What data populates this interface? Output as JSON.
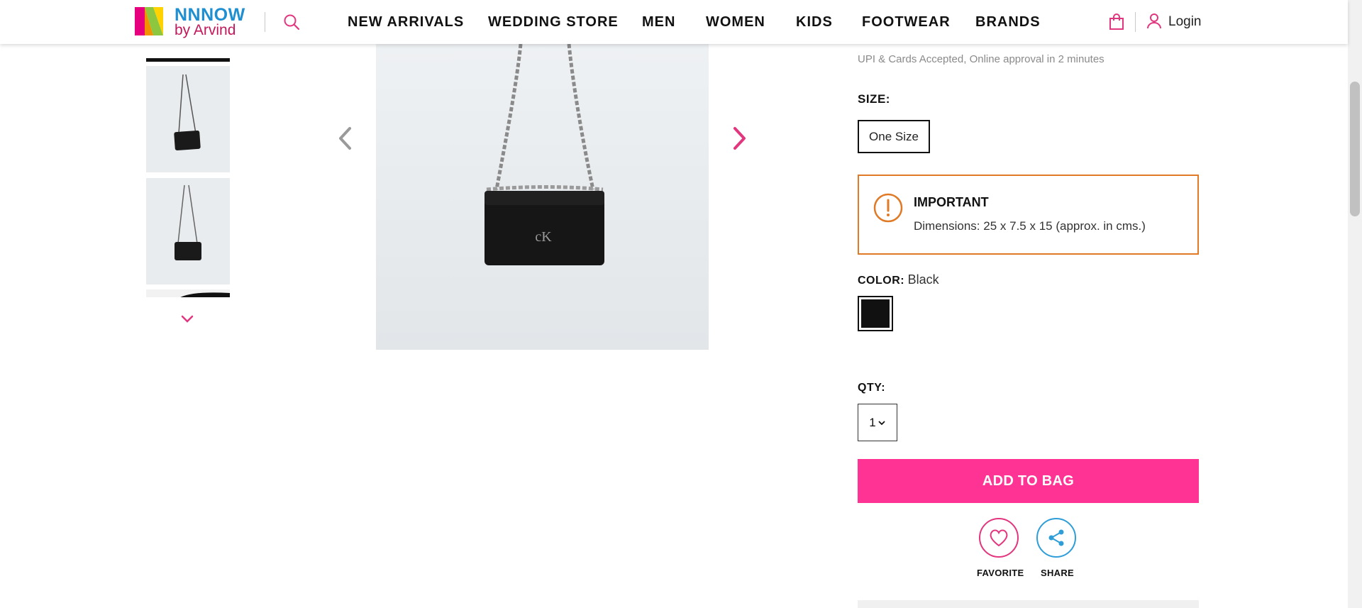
{
  "header": {
    "logo_line1": "NNNOW",
    "logo_line2": "by Arvind",
    "nav": [
      "NEW ARRIVALS",
      "WEDDING STORE",
      "MEN",
      "WOMEN",
      "KIDS",
      "FOOTWEAR",
      "BRANDS"
    ],
    "login_label": "Login"
  },
  "product": {
    "emi_line2": "UPI & Cards Accepted, Online approval in 2 minutes",
    "size_label": "SIZE:",
    "size_option": "One Size",
    "important_title": "IMPORTANT",
    "important_text": "Dimensions: 25 x 7.5 x 15 (approx. in cms.)",
    "color_label": "COLOR:",
    "color_value": "Black",
    "qty_label": "QTY:",
    "qty_value": "1",
    "add_to_bag": "ADD TO BAG",
    "favorite_label": "FAVORITE",
    "share_label": "SHARE"
  },
  "colors": {
    "accent": "#ff3393",
    "brand_blue": "#1f8fd1",
    "warning": "#e07a26",
    "swatch": "#111111"
  }
}
